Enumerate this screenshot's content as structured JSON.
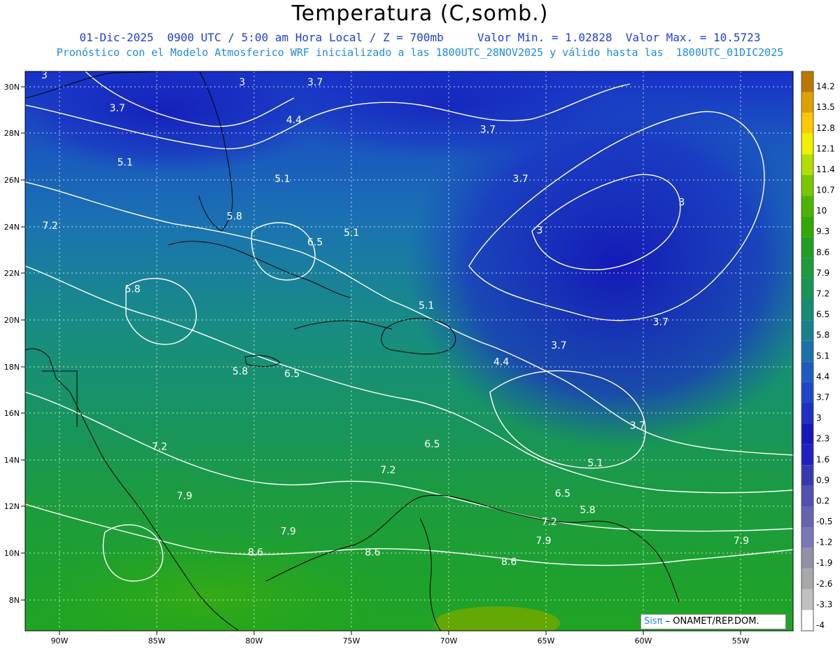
{
  "header": {
    "title": "Temperatura (C,somb.)",
    "line1": "01-Dic-2025  0900 UTC / 5:00 am Hora Local / Z = 700mb     Valor Min. = 1.02828  Valor Max. = 10.5723",
    "line2": "Pronóstico con el Modelo Atmosferico WRF inicializado a las 1800UTC_28NOV2025 y válido hasta las  1800UTC_01DIC2025"
  },
  "map": {
    "lon_range": [
      -92.5,
      -52.5
    ],
    "lat_range": [
      6.8,
      30.6
    ],
    "lat_ticks": [
      "30N",
      "28N",
      "26N",
      "24N",
      "22N",
      "20N",
      "18N",
      "16N",
      "14N",
      "12N",
      "10N",
      "8N"
    ],
    "lon_ticks": [
      "90W",
      "85W",
      "80W",
      "75W",
      "70W",
      "65W",
      "60W",
      "55W"
    ],
    "grid_style": "dotted",
    "contour_labels": [
      {
        "text": "3",
        "lon": -91.5,
        "lat": 30.3
      },
      {
        "text": "3",
        "lon": -81.2,
        "lat": 30.0
      },
      {
        "text": "3.7",
        "lon": -77.4,
        "lat": 30.0
      },
      {
        "text": "3.7",
        "lon": -87.7,
        "lat": 28.9
      },
      {
        "text": "4.4",
        "lon": -78.5,
        "lat": 28.4
      },
      {
        "text": "3.7",
        "lon": -68.4,
        "lat": 28.0
      },
      {
        "text": "5.1",
        "lon": -87.3,
        "lat": 26.6
      },
      {
        "text": "5.1",
        "lon": -79.1,
        "lat": 25.9
      },
      {
        "text": "3.7",
        "lon": -66.7,
        "lat": 25.9
      },
      {
        "text": "3",
        "lon": -58.3,
        "lat": 24.9
      },
      {
        "text": "5.8",
        "lon": -81.6,
        "lat": 24.3
      },
      {
        "text": "7.2",
        "lon": -91.2,
        "lat": 23.9
      },
      {
        "text": "5.1",
        "lon": -75.5,
        "lat": 23.6
      },
      {
        "text": "3",
        "lon": -65.7,
        "lat": 23.7
      },
      {
        "text": "6.5",
        "lon": -77.4,
        "lat": 23.2
      },
      {
        "text": "5.8",
        "lon": -86.9,
        "lat": 21.2
      },
      {
        "text": "5.1",
        "lon": -71.6,
        "lat": 20.5
      },
      {
        "text": "3.7",
        "lon": -59.4,
        "lat": 19.8
      },
      {
        "text": "3.7",
        "lon": -64.7,
        "lat": 18.8
      },
      {
        "text": "4.4",
        "lon": -67.7,
        "lat": 18.1
      },
      {
        "text": "5.8",
        "lon": -81.3,
        "lat": 17.7
      },
      {
        "text": "6.5",
        "lon": -78.6,
        "lat": 17.6
      },
      {
        "text": "3.7",
        "lon": -60.6,
        "lat": 15.4
      },
      {
        "text": "7.2",
        "lon": -85.5,
        "lat": 14.5
      },
      {
        "text": "6.5",
        "lon": -71.3,
        "lat": 14.6
      },
      {
        "text": "5.1",
        "lon": -62.8,
        "lat": 13.8
      },
      {
        "text": "7.2",
        "lon": -73.6,
        "lat": 13.5
      },
      {
        "text": "6.5",
        "lon": -64.5,
        "lat": 12.5
      },
      {
        "text": "7.9",
        "lon": -84.2,
        "lat": 12.4
      },
      {
        "text": "5.8",
        "lon": -63.2,
        "lat": 11.8
      },
      {
        "text": "7.2",
        "lon": -65.2,
        "lat": 11.3
      },
      {
        "text": "7.9",
        "lon": -78.8,
        "lat": 10.9
      },
      {
        "text": "7.9",
        "lon": -65.5,
        "lat": 10.5
      },
      {
        "text": "7.9",
        "lon": -55.2,
        "lat": 10.5
      },
      {
        "text": "8.6",
        "lon": -80.5,
        "lat": 10.0
      },
      {
        "text": "8.6",
        "lon": -74.4,
        "lat": 10.0
      },
      {
        "text": "8.6",
        "lon": -67.3,
        "lat": 9.6
      }
    ]
  },
  "legend": {
    "values": [
      "14.2",
      "13.5",
      "12.8",
      "12.1",
      "11.4",
      "10.7",
      "10",
      "9.3",
      "8.6",
      "7.9",
      "7.2",
      "6.5",
      "5.8",
      "5.1",
      "4.4",
      "3.7",
      "3",
      "2.3",
      "1.6",
      "0.9",
      "0.2",
      "-0.5",
      "-1.2",
      "-1.9",
      "-2.6",
      "-3.3",
      "-4"
    ],
    "colors": [
      "#b87800",
      "#e0a000",
      "#ffc800",
      "#f0f000",
      "#b0e000",
      "#78c800",
      "#4cb400",
      "#30aa00",
      "#20a020",
      "#1c9c3c",
      "#189458",
      "#148c70",
      "#18808c",
      "#1a70a8",
      "#1c5cc0",
      "#1c48c8",
      "#1c30c4",
      "#1418b8",
      "#2020c0",
      "#3838b0",
      "#5050b0",
      "#6464b0",
      "#7878b8",
      "#9090a8",
      "#a8a8a8",
      "#c0c0c0",
      "#ffffff"
    ]
  },
  "credit": {
    "brand": "Sisπ",
    "org": " – ONAMET/REP.DOM."
  }
}
